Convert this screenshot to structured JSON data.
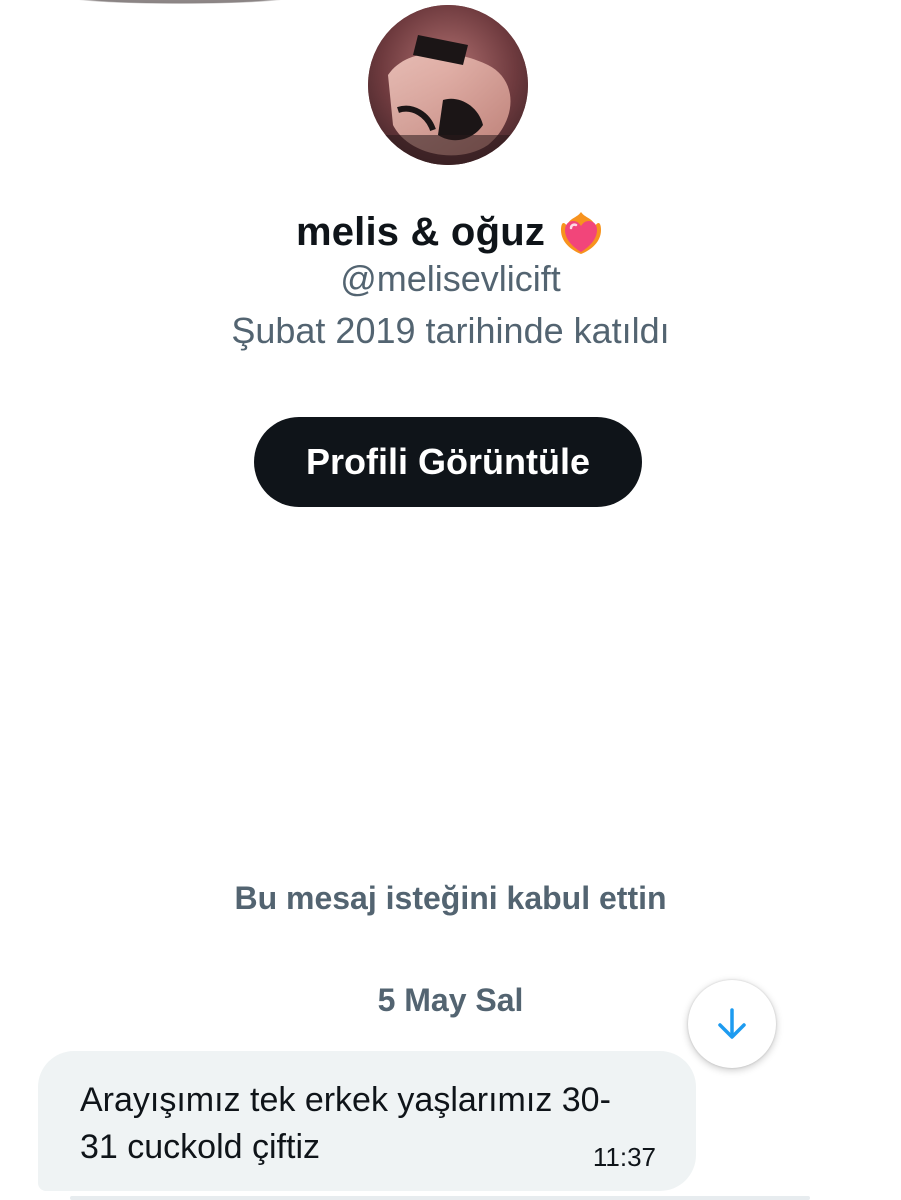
{
  "profile": {
    "display_name": "melis & oğuz",
    "handle": "@melisevlicift",
    "joined": "Şubat 2019 tarihinde katıldı",
    "name_emoji_icon": "heart-on-fire-icon"
  },
  "actions": {
    "view_profile_label": "Profili Görüntüle"
  },
  "conversation": {
    "request_note": "Bu mesaj isteğini kabul ettin",
    "date_separator": "5 May Sal",
    "scroll_icon": "arrow-down-icon",
    "messages": [
      {
        "text": "Arayışımız tek erkek yaşlarımız 30-31 cuckold çiftiz",
        "time": "11:37"
      }
    ]
  },
  "colors": {
    "text_primary": "#0f1419",
    "text_secondary": "#536471",
    "button_bg": "#0f1419",
    "bubble_bg": "#eff3f4",
    "accent_blue": "#1d9bf0"
  }
}
